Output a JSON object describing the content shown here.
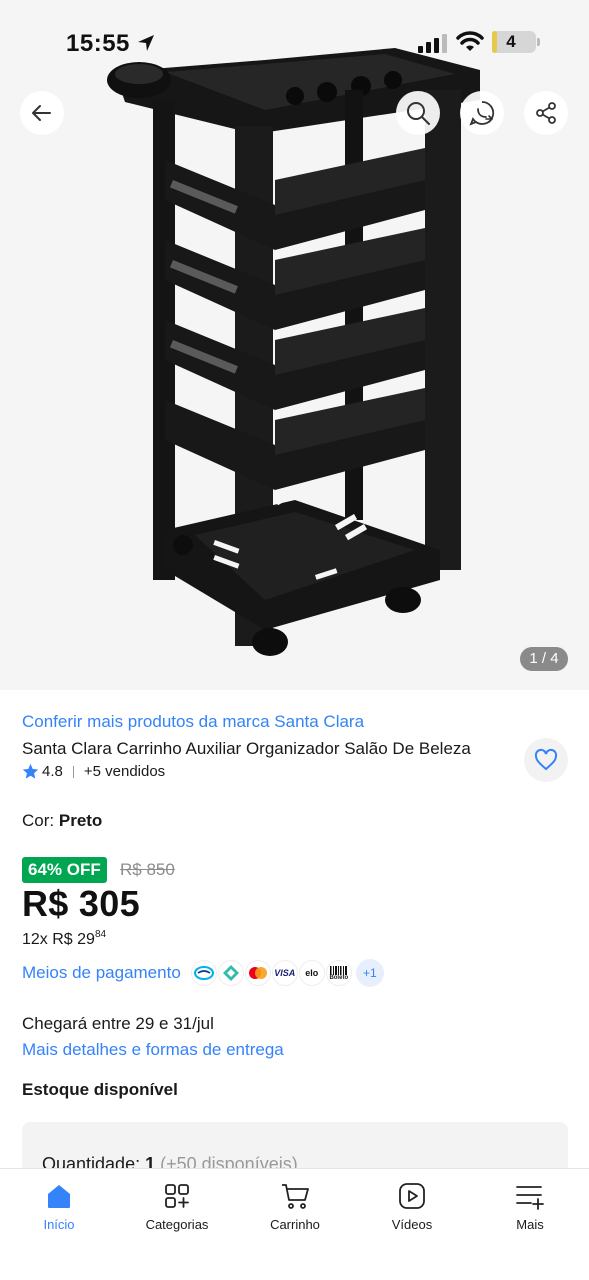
{
  "status_bar": {
    "time": "15:55",
    "battery_level": "4",
    "battery_fraction": 0.12,
    "battery_color": "#e8c84a"
  },
  "gallery": {
    "counter": "1 / 4",
    "icons": [
      "back-arrow-icon",
      "search-icon",
      "whatsapp-icon",
      "share-icon"
    ]
  },
  "product": {
    "brand_link": "Conferir mais produtos da marca Santa Clara",
    "title": "Santa Clara Carrinho Auxiliar Organizador Salão De Beleza",
    "rating": "4.8",
    "sold": "+5 vendidos",
    "color_label": "Cor:",
    "color_value": "Preto",
    "discount": "64% OFF",
    "old_price": "R$ 850",
    "price": "R$ 305",
    "installments_prefix": "12x R$ 29",
    "installments_cents": "84",
    "payment_link": "Meios de pagamento",
    "payment_methods": [
      "mercado-pago-icon",
      "pix-icon",
      "mastercard-icon",
      "visa-icon",
      "elo-icon",
      "boleto-icon"
    ],
    "payment_labels": {
      "visa": "VISA",
      "elo": "elo",
      "boleto": "Boleto"
    },
    "payment_more": "+1",
    "delivery": "Chegará entre 29 e 31/jul",
    "delivery_link": "Mais detalhes e formas de entrega",
    "stock": "Estoque disponível",
    "quantity_label": "Quantidade:",
    "quantity_value": "1",
    "quantity_available": "(+50 disponíveis)"
  },
  "tabbar": {
    "items": [
      {
        "label": "Início",
        "icon": "home-icon",
        "active": true
      },
      {
        "label": "Categorias",
        "icon": "categories-icon",
        "active": false
      },
      {
        "label": "Carrinho",
        "icon": "cart-icon",
        "active": false
      },
      {
        "label": "Vídeos",
        "icon": "video-icon",
        "active": false
      },
      {
        "label": "Mais",
        "icon": "more-menu-icon",
        "active": false
      }
    ]
  },
  "colors": {
    "accent": "#3483fa",
    "discount_green": "#00a650",
    "text": "#1a1a1a",
    "muted": "#8c8c8c"
  }
}
